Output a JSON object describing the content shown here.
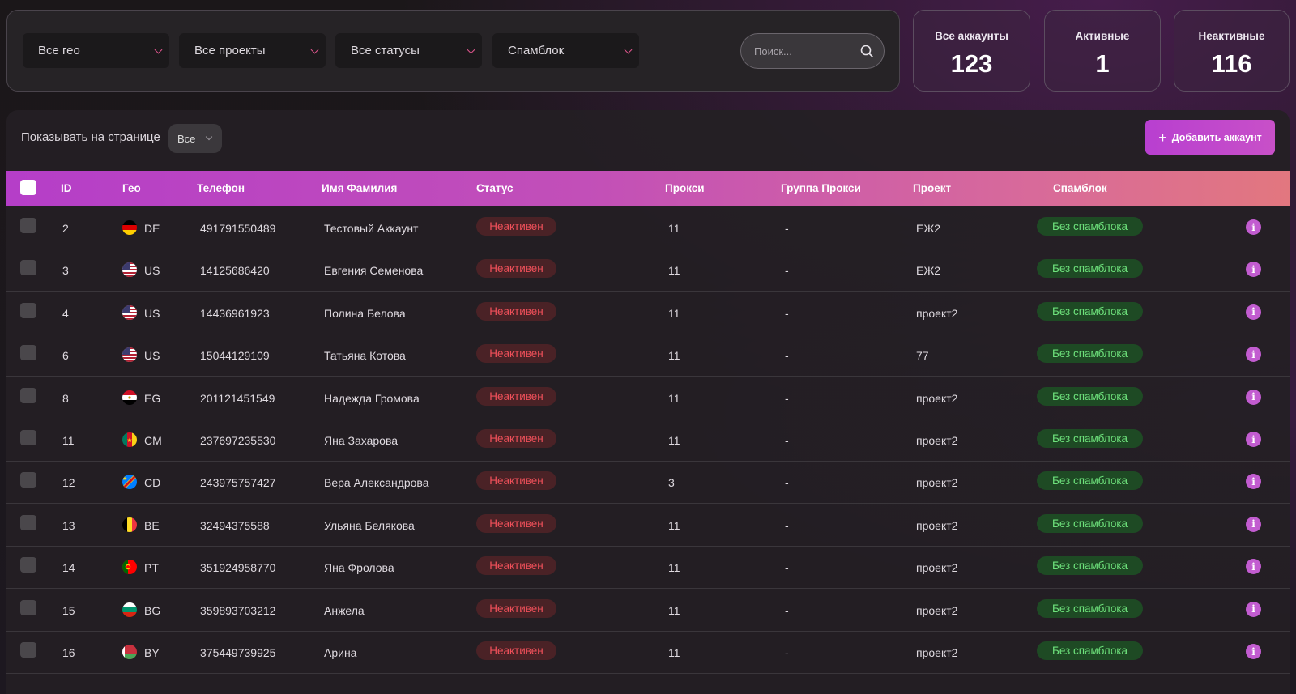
{
  "filters": {
    "geo": "Все гео",
    "projects": "Все проекты",
    "statuses": "Все статусы",
    "spamblock": "Спамблок",
    "search_placeholder": "Поиск..."
  },
  "stats": [
    {
      "label": "Все аккаунты",
      "value": "123"
    },
    {
      "label": "Активные",
      "value": "1"
    },
    {
      "label": "Неактивные",
      "value": "116"
    }
  ],
  "toolbar": {
    "page_size_label": "Показывать на странице",
    "page_size_value": "Все",
    "add_label": "Добавить аккаунт"
  },
  "columns": [
    "ID",
    "Гео",
    "Телефон",
    "Имя Фамилия",
    "Статус",
    "Прокси",
    "Группа Прокси",
    "Проект",
    "Спамблок"
  ],
  "rows": [
    {
      "id": "2",
      "geo": "DE",
      "phone": "491791550489",
      "name": "Тестовый Аккаунт",
      "status": "Неактивен",
      "proxy": "11",
      "proxy_group": "-",
      "project": "ЕЖ2",
      "spamblock": "Без спамблока"
    },
    {
      "id": "3",
      "geo": "US",
      "phone": "14125686420",
      "name": "Евгения Семенова",
      "status": "Неактивен",
      "proxy": "11",
      "proxy_group": "-",
      "project": "ЕЖ2",
      "spamblock": "Без спамблока"
    },
    {
      "id": "4",
      "geo": "US",
      "phone": "14436961923",
      "name": "Полина Белова",
      "status": "Неактивен",
      "proxy": "11",
      "proxy_group": "-",
      "project": "проект2",
      "spamblock": "Без спамблока"
    },
    {
      "id": "6",
      "geo": "US",
      "phone": "15044129109",
      "name": "Татьяна Котова",
      "status": "Неактивен",
      "proxy": "11",
      "proxy_group": "-",
      "project": "77",
      "spamblock": "Без спамблока"
    },
    {
      "id": "8",
      "geo": "EG",
      "phone": "201121451549",
      "name": "Надежда Громова",
      "status": "Неактивен",
      "proxy": "11",
      "proxy_group": "-",
      "project": "проект2",
      "spamblock": "Без спамблока"
    },
    {
      "id": "11",
      "geo": "CM",
      "phone": "237697235530",
      "name": "Яна Захарова",
      "status": "Неактивен",
      "proxy": "11",
      "proxy_group": "-",
      "project": "проект2",
      "spamblock": "Без спамблока"
    },
    {
      "id": "12",
      "geo": "CD",
      "phone": "243975757427",
      "name": "Вера Александрова",
      "status": "Неактивен",
      "proxy": "3",
      "proxy_group": "-",
      "project": "проект2",
      "spamblock": "Без спамблока"
    },
    {
      "id": "13",
      "geo": "BE",
      "phone": "32494375588",
      "name": "Ульяна Белякова",
      "status": "Неактивен",
      "proxy": "11",
      "proxy_group": "-",
      "project": "проект2",
      "spamblock": "Без спамблока"
    },
    {
      "id": "14",
      "geo": "PT",
      "phone": "351924958770",
      "name": "Яна Фролова",
      "status": "Неактивен",
      "proxy": "11",
      "proxy_group": "-",
      "project": "проект2",
      "spamblock": "Без спамблока"
    },
    {
      "id": "15",
      "geo": "BG",
      "phone": "359893703212",
      "name": "Анжела",
      "status": "Неактивен",
      "proxy": "11",
      "proxy_group": "-",
      "project": "проект2",
      "spamblock": "Без спамблока"
    },
    {
      "id": "16",
      "geo": "BY",
      "phone": "375449739925",
      "name": "Арина",
      "status": "Неактивен",
      "proxy": "11",
      "proxy_group": "-",
      "project": "проект2",
      "spamblock": "Без спамблока"
    }
  ],
  "colors": {
    "accent": "#c24fc8",
    "status_inactive": "#f0505a",
    "spamblock_ok": "#6ee27c"
  },
  "icons": {
    "info": "info-icon",
    "search": "search-icon",
    "chevron": "chevron-down-icon",
    "plus": "plus-icon"
  }
}
